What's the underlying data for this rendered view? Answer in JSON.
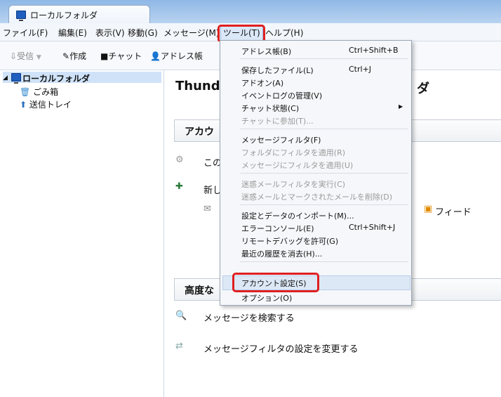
{
  "window": {
    "tab_title": "ローカルフォルダ"
  },
  "menubar": [
    "ファイル(F)",
    "編集(E)",
    "表示(V)",
    "移動(G)",
    "メッセージ(M)",
    "ツール(T)",
    "ヘルプ(H)"
  ],
  "toolbar": {
    "receive": "受信",
    "compose": "作成",
    "chat": "チャット",
    "address_book": "アドレス帳"
  },
  "sidebar": {
    "root": "ローカルフォルダ",
    "trash": "ごみ箱",
    "outbox": "送信トレイ"
  },
  "main": {
    "heading": "Thund",
    "heading_tail": "ダ",
    "accounts_head": "アカウ",
    "line1": "この",
    "line2": "新し",
    "feed": "フィード",
    "advanced_head": "高度な",
    "search_messages": "メッセージを検索する",
    "filter_settings": "メッセージフィルタの設定を変更する"
  },
  "tools_menu": {
    "items": [
      {
        "label": "アドレス帳(B)",
        "shortcut": "Ctrl+Shift+B"
      },
      {
        "label": "保存したファイル(L)",
        "shortcut": "Ctrl+J"
      },
      {
        "label": "アドオン(A)",
        "shortcut": ""
      },
      {
        "label": "イベントログの管理(V)",
        "shortcut": ""
      },
      {
        "label": "チャット状態(C)",
        "shortcut": ""
      },
      {
        "label": "チャットに参加(T)...",
        "shortcut": ""
      },
      {
        "label": "メッセージフィルタ(F)",
        "shortcut": ""
      },
      {
        "label": "フォルダにフィルタを適用(R)",
        "shortcut": ""
      },
      {
        "label": "メッセージにフィルタを適用(U)",
        "shortcut": ""
      },
      {
        "label": "迷惑メールフィルタを実行(C)",
        "shortcut": ""
      },
      {
        "label": "迷惑メールとマークされたメールを削除(D)",
        "shortcut": ""
      },
      {
        "label": "設定とデータのインポート(M)...",
        "shortcut": ""
      },
      {
        "label": "エラーコンソール(E)",
        "shortcut": "Ctrl+Shift+J"
      },
      {
        "label": "リモートデバッグを許可(G)",
        "shortcut": ""
      },
      {
        "label": "最近の履歴を消去(H)...",
        "shortcut": ""
      },
      {
        "label": "アカウント設定(S)",
        "shortcut": ""
      },
      {
        "label": "オプション(O)",
        "shortcut": ""
      }
    ]
  },
  "colors": {
    "highlight_box": "#e02020",
    "accent": "#1f5fbf"
  }
}
